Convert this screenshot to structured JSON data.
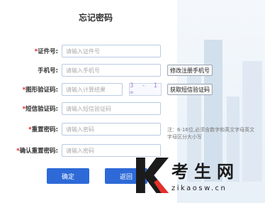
{
  "page": {
    "title": "忘记密码"
  },
  "form": {
    "rows": [
      {
        "label": "证件号:",
        "required": true,
        "placeholder": "请输入证件号"
      },
      {
        "label": "手机号:",
        "required": false,
        "placeholder": "请输入手机号",
        "side_button": "修改注册手机号"
      },
      {
        "label": "图形验证码:",
        "required": true,
        "placeholder": "请输入计算结果",
        "captcha_text": "3 - 1 =",
        "side_button": "获取短信验证码"
      },
      {
        "label": "短信验证码:",
        "required": true,
        "placeholder": "请输入短信验证码"
      },
      {
        "label": "重置密码:",
        "required": true,
        "placeholder": "请输入密码"
      },
      {
        "label": "确认重置密码:",
        "required": true,
        "placeholder": "请输入密码"
      }
    ],
    "note": "注：6-16位,必须含数字和英文字母英文字母区分大小写",
    "confirm_label": "确定",
    "back_label": "返回"
  },
  "watermark": {
    "brand": "考生网",
    "url": "zikaosw.cn"
  }
}
